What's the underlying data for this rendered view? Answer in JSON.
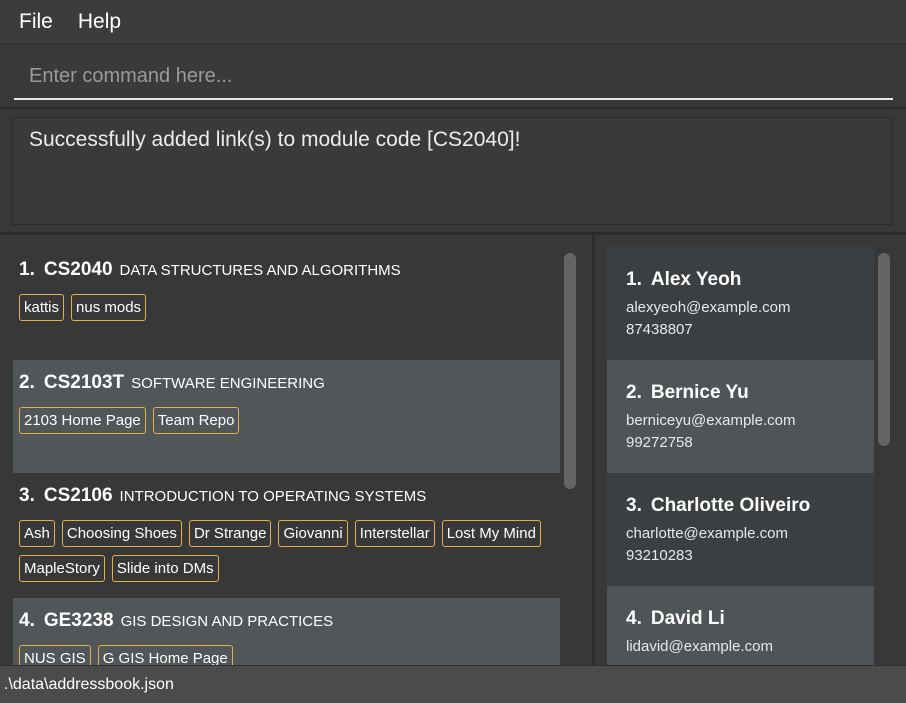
{
  "menu": {
    "file": "File",
    "help": "Help"
  },
  "command": {
    "placeholder": "Enter command here...",
    "value": ""
  },
  "result": {
    "message": "Successfully added link(s) to module code [CS2040]!"
  },
  "modules": [
    {
      "index": "1.",
      "code": "CS2040",
      "name": "DATA STRUCTURES AND ALGORITHMS",
      "tags": [
        "kattis",
        "nus mods"
      ]
    },
    {
      "index": "2.",
      "code": "CS2103T",
      "name": "SOFTWARE ENGINEERING",
      "tags": [
        "2103 Home Page",
        "Team Repo"
      ]
    },
    {
      "index": "3.",
      "code": "CS2106",
      "name": "INTRODUCTION TO OPERATING SYSTEMS",
      "tags": [
        "Ash",
        "Choosing Shoes",
        "Dr Strange",
        "Giovanni",
        "Interstellar",
        "Lost My Mind",
        "MapleStory",
        "Slide into DMs"
      ]
    },
    {
      "index": "4.",
      "code": "GE3238",
      "name": "GIS DESIGN AND PRACTICES",
      "tags": [
        "NUS GIS",
        "G GIS Home Page"
      ]
    }
  ],
  "persons": [
    {
      "index": "1.",
      "name": "Alex Yeoh",
      "email": "alexyeoh@example.com",
      "phone": "87438807"
    },
    {
      "index": "2.",
      "name": "Bernice Yu",
      "email": "berniceyu@example.com",
      "phone": "99272758"
    },
    {
      "index": "3.",
      "name": "Charlotte Oliveiro",
      "email": "charlotte@example.com",
      "phone": "93210283"
    },
    {
      "index": "4.",
      "name": "David Li",
      "email": "lidavid@example.com",
      "phone": ""
    }
  ],
  "status": {
    "path": ".\\data\\addressbook.json"
  },
  "colors": {
    "tag_border": "#e3b04b",
    "background": "#383838",
    "alt_row": "#515658"
  }
}
